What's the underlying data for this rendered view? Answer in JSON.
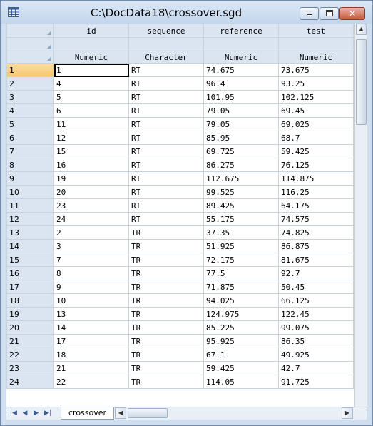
{
  "window": {
    "title": "C:\\DocData18\\crossover.sgd"
  },
  "grid": {
    "columns": [
      {
        "name": "id",
        "type": "Numeric"
      },
      {
        "name": "sequence",
        "type": "Character"
      },
      {
        "name": "reference",
        "type": "Numeric"
      },
      {
        "name": "test",
        "type": "Numeric"
      }
    ],
    "rows": [
      [
        "1",
        "1",
        "RT",
        "74.675",
        "73.675"
      ],
      [
        "2",
        "4",
        "RT",
        "96.4",
        "93.25"
      ],
      [
        "3",
        "5",
        "RT",
        "101.95",
        "102.125"
      ],
      [
        "4",
        "6",
        "RT",
        "79.05",
        "69.45"
      ],
      [
        "5",
        "11",
        "RT",
        "79.05",
        "69.025"
      ],
      [
        "6",
        "12",
        "RT",
        "85.95",
        "68.7"
      ],
      [
        "7",
        "15",
        "RT",
        "69.725",
        "59.425"
      ],
      [
        "8",
        "16",
        "RT",
        "86.275",
        "76.125"
      ],
      [
        "9",
        "19",
        "RT",
        "112.675",
        "114.875"
      ],
      [
        "10",
        "20",
        "RT",
        "99.525",
        "116.25"
      ],
      [
        "11",
        "23",
        "RT",
        "89.425",
        "64.175"
      ],
      [
        "12",
        "24",
        "RT",
        "55.175",
        "74.575"
      ],
      [
        "13",
        "2",
        "TR",
        "37.35",
        "74.825"
      ],
      [
        "14",
        "3",
        "TR",
        "51.925",
        "86.875"
      ],
      [
        "15",
        "7",
        "TR",
        "72.175",
        "81.675"
      ],
      [
        "16",
        "8",
        "TR",
        "77.5",
        "92.7"
      ],
      [
        "17",
        "9",
        "TR",
        "71.875",
        "50.45"
      ],
      [
        "18",
        "10",
        "TR",
        "94.025",
        "66.125"
      ],
      [
        "19",
        "13",
        "TR",
        "124.975",
        "122.45"
      ],
      [
        "20",
        "14",
        "TR",
        "85.225",
        "99.075"
      ],
      [
        "21",
        "17",
        "TR",
        "95.925",
        "86.35"
      ],
      [
        "22",
        "18",
        "TR",
        "67.1",
        "49.925"
      ],
      [
        "23",
        "21",
        "TR",
        "59.425",
        "42.7"
      ],
      [
        "24",
        "22",
        "TR",
        "114.05",
        "91.725"
      ]
    ]
  },
  "sheet_tab": "crossover",
  "icons": {
    "app": "spreadsheet-icon",
    "minimize": "minimize-icon",
    "maximize": "maximize-icon",
    "close": "close-icon"
  },
  "colors": {
    "selected_header": "#f6c56f",
    "header_bg": "#dbe5f1",
    "title_bg": "#c3d6ec"
  }
}
